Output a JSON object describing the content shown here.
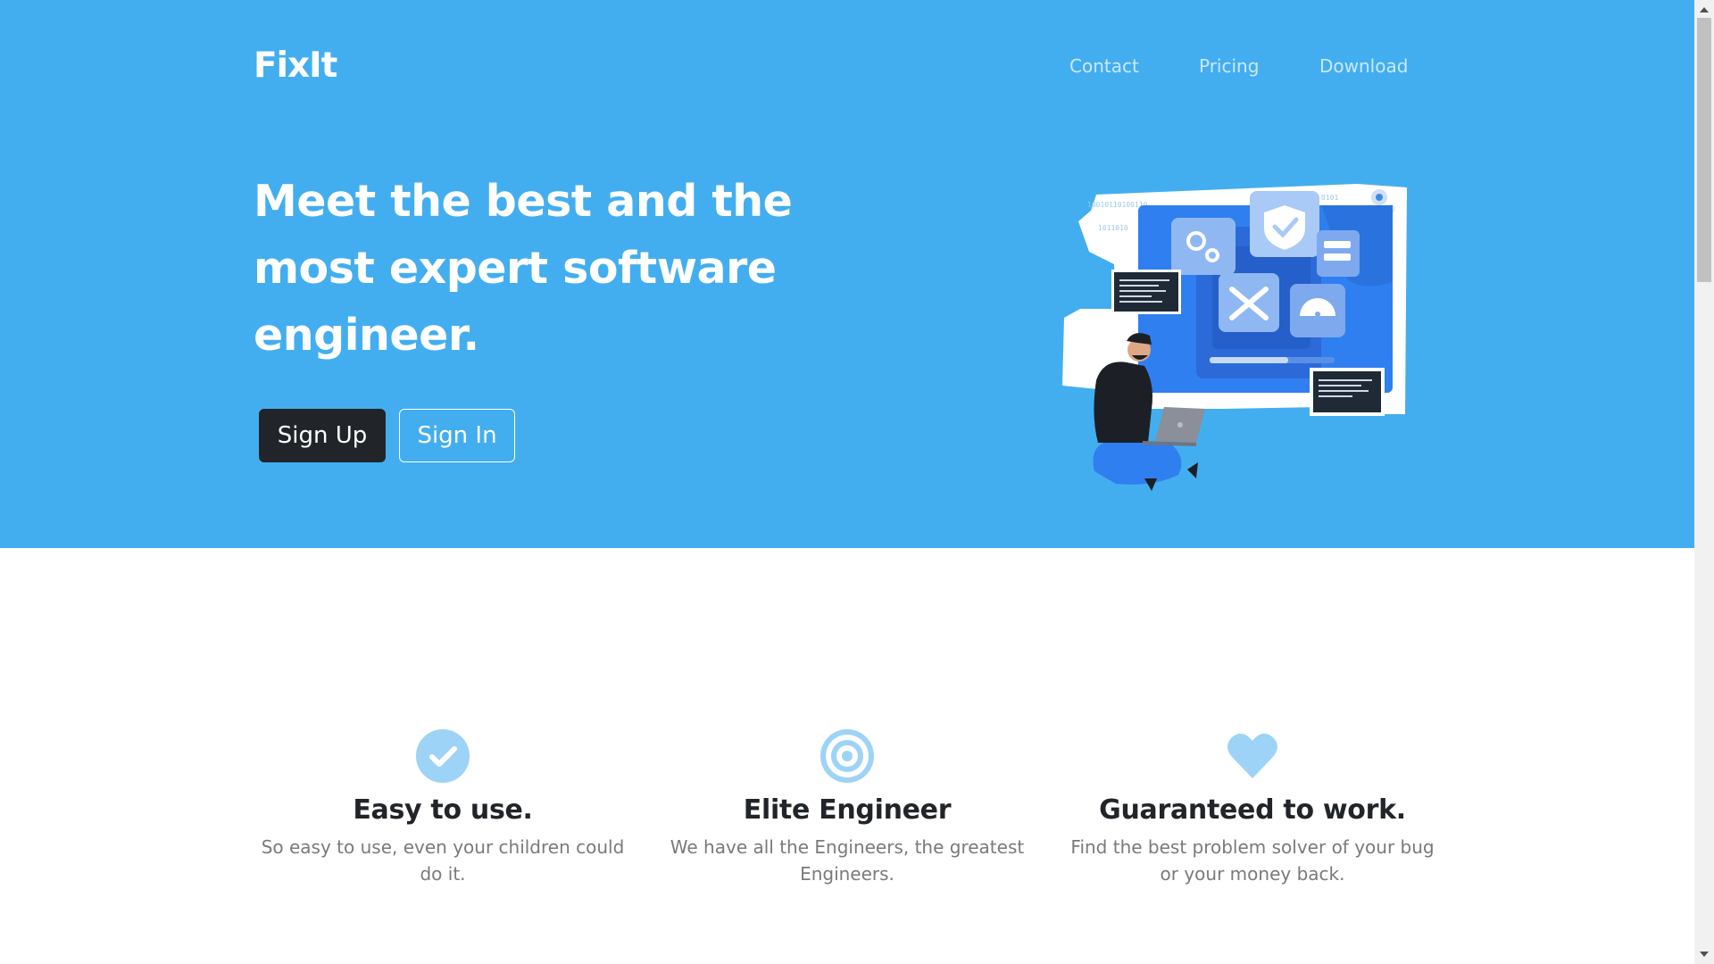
{
  "brand": {
    "logo": "FixIt"
  },
  "nav": {
    "items": [
      "Contact",
      "Pricing",
      "Download"
    ]
  },
  "hero": {
    "headline": "Meet the best and the most expert software engineer.",
    "signup_label": "Sign Up",
    "signin_label": "Sign In",
    "background_color": "#43aeef"
  },
  "features": [
    {
      "icon": "check-circle-icon",
      "title": "Easy to use.",
      "text": "So easy to use, even your children could do it."
    },
    {
      "icon": "bullseye-icon",
      "title": "Elite Engineer",
      "text": "We have all the Engineers, the greatest Engineers."
    },
    {
      "icon": "heart-icon",
      "title": "Guaranteed to work.",
      "text": "Find the best problem solver of your bug or your money back."
    }
  ],
  "colors": {
    "accent": "#43aeef",
    "icon": "#9dd3f6",
    "dark_button": "#212529",
    "heading": "#212529",
    "body_text": "#7a7a7a"
  }
}
